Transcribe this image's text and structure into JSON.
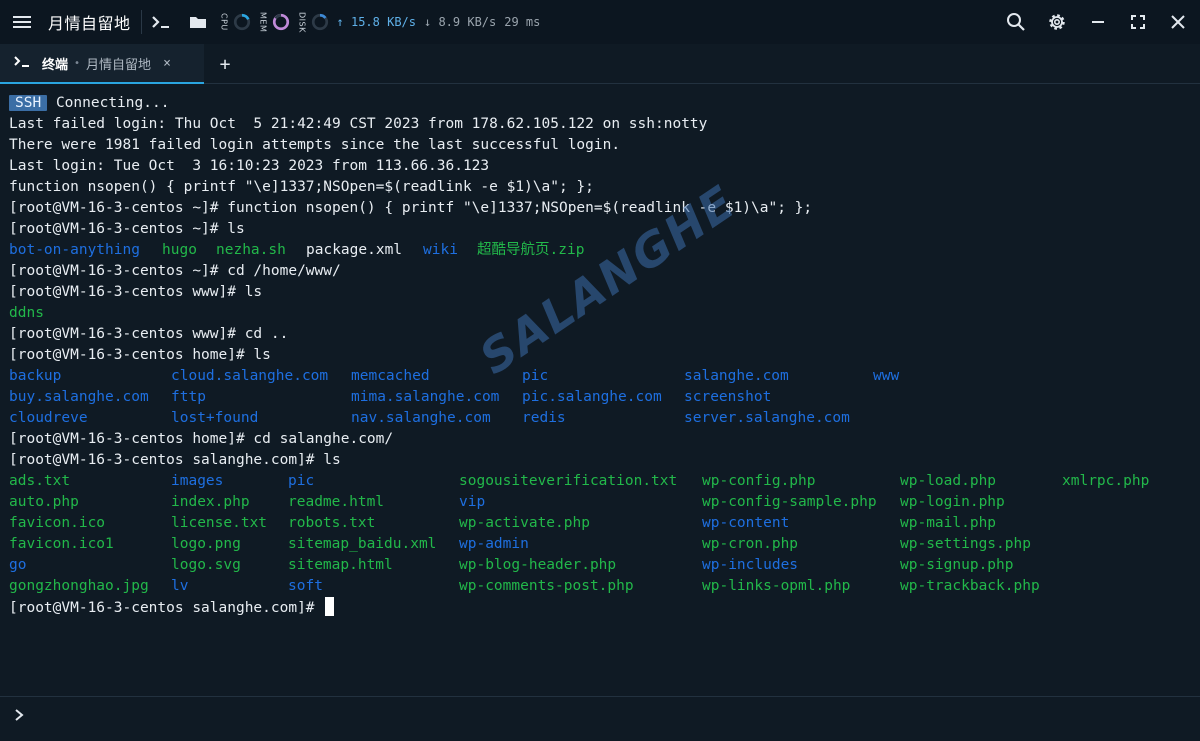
{
  "titlebar": {
    "app_title": "月情自留地",
    "cpu_label": "CPU",
    "mem_label": "MEM",
    "disk_label": "DISK",
    "net_up": "↑ 15.8 KB/s",
    "net_down": "↓ 8.9 KB/s",
    "latency": "29 ms",
    "icons": [
      "menu-icon",
      "terminal-prompt-icon",
      "folder-icon",
      "search-icon",
      "gear-icon",
      "minimize-icon",
      "maximize-icon",
      "close-icon"
    ]
  },
  "tabs": {
    "active_name": "终端",
    "active_sep": "•",
    "active_host": "月情自留地",
    "close_glyph": "×",
    "new_tab_glyph": "+"
  },
  "terminal": {
    "badge": "SSH",
    "connecting": "Connecting...",
    "lines": [
      "Last failed login: Thu Oct  5 21:42:49 CST 2023 from 178.62.105.122 on ssh:notty",
      "There were 1981 failed login attempts since the last successful login.",
      "Last login: Tue Oct  3 16:10:23 2023 from 113.66.36.123",
      "function nsopen() { printf \"\\e]1337;NSOpen=$(readlink -e $1)\\a\"; };",
      "[root@VM-16-3-centos ~]# function nsopen() { printf \"\\e]1337;NSOpen=$(readlink -e $1)\\a\"; };",
      "[root@VM-16-3-centos ~]# ls"
    ],
    "ls_root": [
      "bot-on-anything",
      "hugo",
      "nezha.sh",
      "package.xml",
      "wiki",
      "超酷导航页.zip"
    ],
    "cmd_cd_www": "[root@VM-16-3-centos ~]# cd /home/www/",
    "cmd_ls_www": "[root@VM-16-3-centos www]# ls",
    "ls_www": [
      "ddns"
    ],
    "cmd_cd_up": "[root@VM-16-3-centos www]# cd ..",
    "cmd_ls_home": "[root@VM-16-3-centos home]# ls",
    "ls_home": [
      [
        "backup",
        "cloud.salanghe.com",
        "memcached",
        "pic",
        "salanghe.com",
        "www"
      ],
      [
        "buy.salanghe.com",
        "fttp",
        "mima.salanghe.com",
        "pic.salanghe.com",
        "screenshot"
      ],
      [
        "cloudreve",
        "lost+found",
        "nav.salanghe.com",
        "redis",
        "server.salanghe.com"
      ]
    ],
    "cmd_cd_site": "[root@VM-16-3-centos home]# cd salanghe.com/",
    "cmd_ls_site": "[root@VM-16-3-centos salanghe.com]# ls",
    "ls_site": [
      [
        "ads.txt",
        "images",
        "pic",
        "sogousiteverification.txt",
        "wp-config.php",
        "wp-load.php",
        "xmlrpc.php"
      ],
      [
        "auto.php",
        "index.php",
        "readme.html",
        "vip",
        "wp-config-sample.php",
        "wp-login.php"
      ],
      [
        "favicon.ico",
        "license.txt",
        "robots.txt",
        "wp-activate.php",
        "wp-content",
        "wp-mail.php"
      ],
      [
        "favicon.ico1",
        "logo.png",
        "sitemap_baidu.xml",
        "wp-admin",
        "wp-cron.php",
        "wp-settings.php"
      ],
      [
        "go",
        "logo.svg",
        "sitemap.html",
        "wp-blog-header.php",
        "wp-includes",
        "wp-signup.php"
      ],
      [
        "gongzhonghao.jpg",
        "lv",
        "soft",
        "wp-comments-post.php",
        "wp-links-opml.php",
        "wp-trackback.php"
      ]
    ],
    "final_prompt": "[root@VM-16-3-centos salanghe.com]# "
  },
  "watermark": "SALANGHE",
  "bottom": {
    "chevron": "›"
  },
  "colors": {
    "background": "#0f1a24",
    "file": "#22b84a",
    "directory": "#1e6fe0",
    "text": "#e8edf2",
    "accent": "#2aa5e0"
  }
}
